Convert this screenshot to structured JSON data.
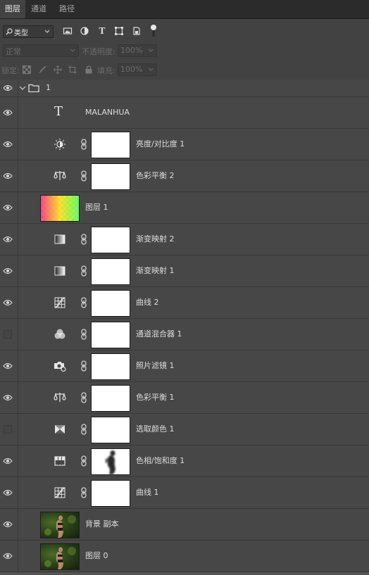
{
  "tabs": [
    {
      "label": "图层"
    },
    {
      "label": "通道"
    },
    {
      "label": "路径"
    }
  ],
  "toolbar": {
    "filter_label": "类型"
  },
  "blend": {
    "mode": "正常",
    "opacity_label": "不透明度:",
    "opacity_value": "100%"
  },
  "lock": {
    "label": "锁定:",
    "fill_label": "填充:",
    "fill_value": "100%"
  },
  "group": {
    "name": "1"
  },
  "layers": [
    {
      "name": "MALANHUA",
      "icon": "text-icon"
    },
    {
      "name": "亮度/对比度 1",
      "icon": "brightness-icon"
    },
    {
      "name": "色彩平衡 2",
      "icon": "color-balance-icon"
    },
    {
      "name": "图层 1",
      "icon": "gradient-thumbnail"
    },
    {
      "name": "渐变映射 2",
      "icon": "gradient-map-icon"
    },
    {
      "name": "渐变映射 1",
      "icon": "gradient-map-icon"
    },
    {
      "name": "曲线 2",
      "icon": "curves-icon"
    },
    {
      "name": "通道混合器 1",
      "icon": "channel-mixer-icon"
    },
    {
      "name": "照片滤镜 1",
      "icon": "photo-filter-icon"
    },
    {
      "name": "色彩平衡 1",
      "icon": "color-balance-icon"
    },
    {
      "name": "选取颜色 1",
      "icon": "selective-color-icon"
    },
    {
      "name": "色相/饱和度 1",
      "icon": "hue-saturation-icon"
    },
    {
      "name": "曲线 1",
      "icon": "curves-icon"
    },
    {
      "name": "背景 副本",
      "icon": "photo-thumbnail"
    },
    {
      "name": "图层 0",
      "icon": "photo-thumbnail"
    }
  ]
}
